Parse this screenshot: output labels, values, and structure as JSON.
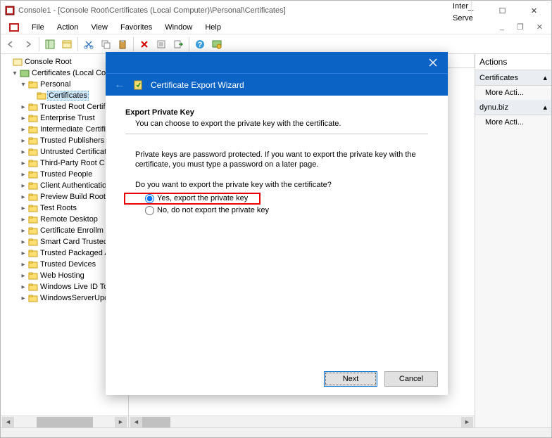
{
  "window": {
    "title": "Console1 - [Console Root\\Certificates (Local Computer)\\Personal\\Certificates]"
  },
  "menubar": {
    "items": [
      "File",
      "Action",
      "View",
      "Favorites",
      "Window",
      "Help"
    ]
  },
  "tree": {
    "root": "Console Root",
    "level1": "Certificates (Local Com",
    "level2": "Personal",
    "selected": "Certificates",
    "nodes": [
      "Trusted Root Certific",
      "Enterprise Trust",
      "Intermediate Certific",
      "Trusted Publishers",
      "Untrusted Certificat",
      "Third-Party Root C",
      "Trusted People",
      "Client Authenticatio",
      "Preview Build Roots",
      "Test Roots",
      "Remote Desktop",
      "Certificate Enrollm",
      "Smart Card Trustec",
      "Trusted Packaged A",
      "Trusted Devices",
      "Web Hosting",
      "Windows Live ID To",
      "WindowsServerUpd"
    ]
  },
  "midHeader": {
    "col1": "Inter",
    "col2": "Serve"
  },
  "actions": {
    "title": "Actions",
    "section1": "Certificates",
    "section2": "dynu.biz",
    "more": "More Acti..."
  },
  "dialog": {
    "title": "Certificate Export Wizard",
    "heading": "Export Private Key",
    "desc": "You can choose to export the private key with the certificate.",
    "para1": "Private keys are password protected. If you want to export the private key with the certificate, you must type a password on a later page.",
    "question": "Do you want to export the private key with the certificate?",
    "opt_yes": "Yes, export the private key",
    "opt_no": "No, do not export the private key",
    "btn_next": "Next",
    "btn_cancel": "Cancel"
  }
}
